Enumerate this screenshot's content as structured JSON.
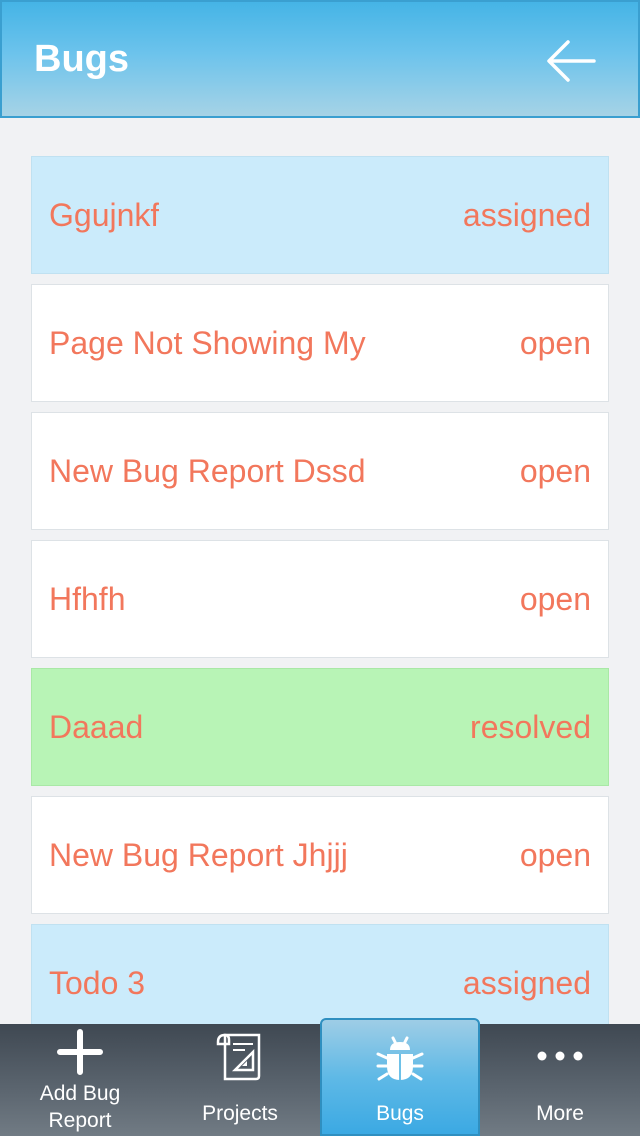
{
  "header": {
    "title": "Bugs",
    "back_icon": "arrow-left-icon"
  },
  "bugs": [
    {
      "title": "Ggujnkf",
      "status": "assigned"
    },
    {
      "title": "Page Not Showing My",
      "status": "open"
    },
    {
      "title": "New Bug Report Dssd",
      "status": "open"
    },
    {
      "title": "Hfhfh",
      "status": "open"
    },
    {
      "title": "Daaad",
      "status": "resolved"
    },
    {
      "title": "New Bug Report Jhjjj",
      "status": "open"
    },
    {
      "title": "Todo 3",
      "status": "assigned"
    }
  ],
  "status_colors": {
    "assigned": "#cbebfb",
    "open": "#ffffff",
    "resolved": "#b8f4b6",
    "text": "#f2775c"
  },
  "tabbar": {
    "tabs": [
      {
        "label": "Add Bug\nReport",
        "icon": "plus-icon"
      },
      {
        "label": "Projects",
        "icon": "projects-icon"
      },
      {
        "label": "Bugs",
        "icon": "bug-icon",
        "active": true
      },
      {
        "label": "More",
        "icon": "more-dots-icon"
      }
    ]
  }
}
